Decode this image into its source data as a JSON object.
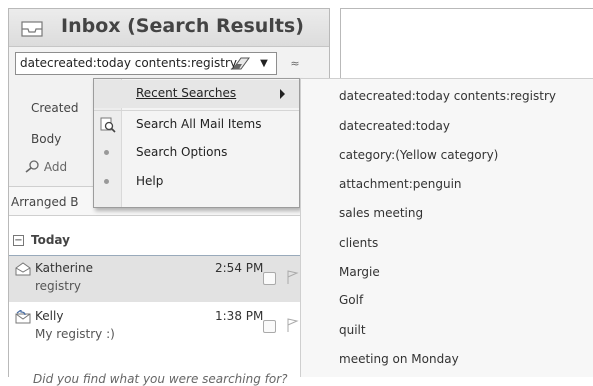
{
  "pane": {
    "title": "Inbox (Search Results)",
    "search_value": "datecreated:today contents:registry",
    "criteria": {
      "created": "Created",
      "body": "Body",
      "add": "Add"
    },
    "arranged_by": "Arranged B",
    "group_label": "Today",
    "mails": [
      {
        "from": "Katherine",
        "subject": "registry",
        "time": "2:54 PM"
      },
      {
        "from": "Kelly",
        "subject": "My registry :)",
        "time": "1:38 PM"
      }
    ],
    "footer_text": "Did you find what you were searching for?"
  },
  "menu": {
    "recent_searches": "Recent Searches",
    "search_all": "Search All Mail Items",
    "search_options": "Search Options",
    "help": "Help"
  },
  "recent_searches": [
    "datecreated:today contents:registry",
    "datecreated:today",
    "category:(Yellow category)",
    "attachment:penguin",
    "sales meeting",
    "clients",
    "Margie",
    "Golf",
    "quilt",
    "meeting on Monday"
  ],
  "icons": [
    "inbox-icon",
    "eraser-icon",
    "dropdown-arrow-icon",
    "expand-chevron-icon",
    "add-criteria-icon",
    "search-icon",
    "envelope-open-icon",
    "envelope-reply-icon",
    "flag-icon",
    "submenu-arrow-icon"
  ]
}
